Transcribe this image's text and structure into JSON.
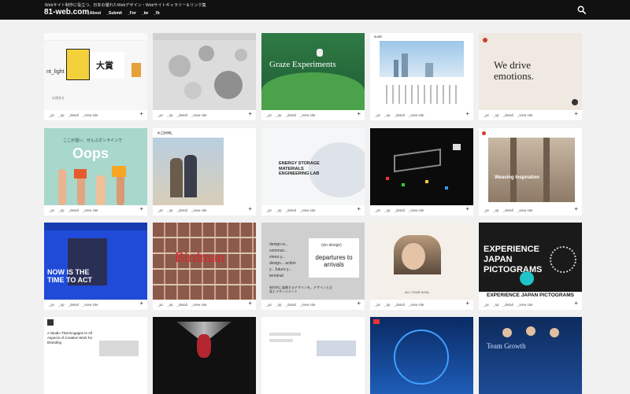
{
  "header": {
    "tagline": "Webサイト制作に役立つ、日本の優れたWebデザイン・Webサイトギャラリー＆リンク集",
    "logo": "81-web.com",
    "nav": [
      "_About",
      "_Submit",
      "_For",
      "_tw",
      "_fb"
    ]
  },
  "card_actions": {
    "pc": "_pc",
    "sp": "_sp",
    "detail": "_detail",
    "view": "_view site",
    "more": "+"
  },
  "thumbnails": {
    "c1_logo": "nt_light",
    "c1_badge": "大賞",
    "c1_meta": "お問合せ",
    "c3_title": "Graze Experiments",
    "c4_brand": "sun8",
    "c5_title": "We drive emotions.",
    "c6_title": "Oops",
    "c6_copy": "ここが違い、ぜんぶオンラインで",
    "c7_brand": "＊ロHHL",
    "c8_title": "ENERGY STORAGE MATERIALS ENGINEERING LAB",
    "c10_title": "Weaving Inspiration",
    "c11_title": "NOW IS THE TIME TO ACT",
    "c12_title": "Birdman",
    "c13_tag": "(wo design)",
    "c13_title": "departures to arrivals",
    "c13_side": "design w... commun... views y... design... action y... future y... terminal",
    "c13_jp": "新作的に楽観するデザインを。デザインと企画とマネージメント",
    "c14_brand": "ALL YOUR SOUL",
    "c15_title": "EXPERIENCE JAPAN PICTOGRAMS",
    "c15_footer": "EXPERIENCE JAPAN PICTOGRAMS",
    "c16_title": "A Studio That Engages In All Aspects of Creative Work for Branding",
    "c20_title": "Team Growth"
  },
  "colors": {
    "header": "#111111",
    "page": "#f1f1f1",
    "accent_red": "#d63a2c"
  }
}
